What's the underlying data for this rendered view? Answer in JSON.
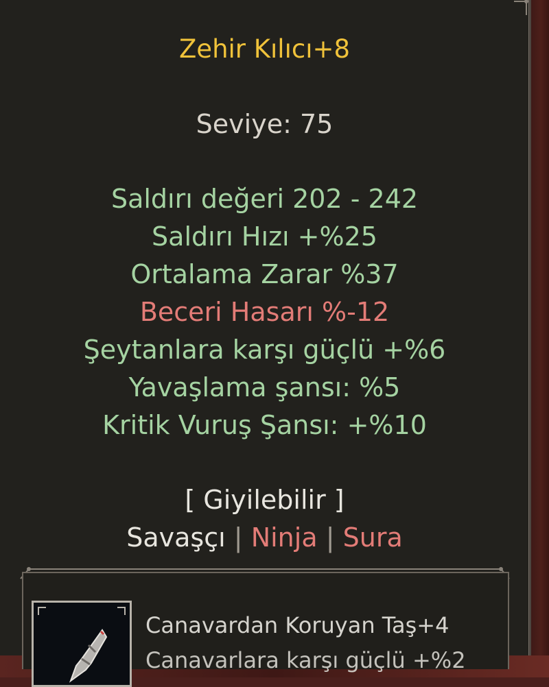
{
  "item": {
    "name": "Zehir Kılıcı+8",
    "level": "Seviye: 75",
    "stats": [
      {
        "text": "Saldırı değeri 202 - 242",
        "color": "green"
      },
      {
        "text": "Saldırı Hızı +%25",
        "color": "green"
      },
      {
        "text": "Ortalama Zarar %37",
        "color": "green"
      },
      {
        "text": "Beceri Hasarı %-12",
        "color": "red"
      },
      {
        "text": "Şeytanlara karşı güçlü +%6",
        "color": "green"
      },
      {
        "text": "Yavaşlama şansı: %5",
        "color": "green"
      },
      {
        "text": "Kritik Vuruş Şansı: +%10",
        "color": "green"
      }
    ],
    "wearable": "[ Giyilebilir ]",
    "classes": {
      "warrior": "Savaşçı",
      "ninja": "Ninja",
      "sura": "Sura",
      "separator": "|"
    }
  },
  "socket": {
    "stone_name": "Canavardan Koruyan Taş+4",
    "stone_effect": "Canavarlara karşı güçlü +%2",
    "icon": "sword-stone-icon"
  },
  "colors": {
    "title": "#f0c23a",
    "stat_green": "#a5d3a2",
    "stat_red": "#e37c77",
    "tooltip_bg": "#22211d"
  }
}
